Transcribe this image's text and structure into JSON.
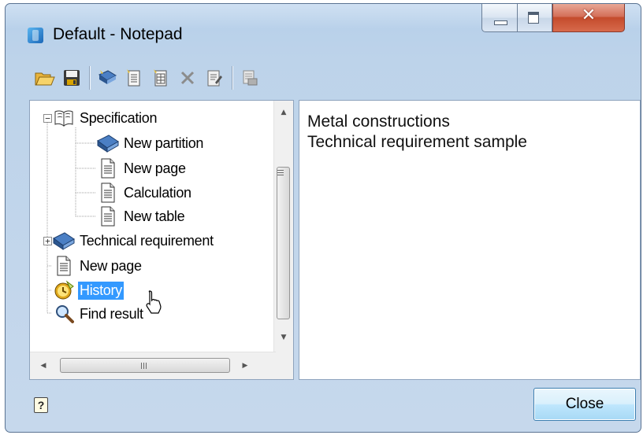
{
  "window": {
    "title": "Default - Notepad"
  },
  "toolbar": {
    "buttons": [
      "open-folder-icon",
      "save-icon",
      "new-partition-icon",
      "new-page-icon",
      "new-table-icon",
      "delete-icon",
      "edit-icon",
      "print-preview-icon"
    ]
  },
  "tree": {
    "items": [
      {
        "label": "Specification",
        "icon": "open-book-icon",
        "expanded": true
      },
      {
        "label": "New partition",
        "icon": "book-icon"
      },
      {
        "label": "New page",
        "icon": "page-icon"
      },
      {
        "label": "Calculation",
        "icon": "page-icon"
      },
      {
        "label": "New table",
        "icon": "page-icon"
      },
      {
        "label": "Technical requirement",
        "icon": "book-icon",
        "expanded": false
      },
      {
        "label": "New page",
        "icon": "page-icon"
      },
      {
        "label": "History",
        "icon": "history-icon",
        "selected": true
      },
      {
        "label": "Find result",
        "icon": "magnifier-icon"
      }
    ]
  },
  "content": {
    "lines": [
      "Metal constructions",
      "Technical requirement sample"
    ]
  },
  "footer": {
    "close_label": "Close",
    "help_glyph": "?"
  },
  "colors": {
    "selection": "#3399ff",
    "close_button": "#c44b2c"
  }
}
